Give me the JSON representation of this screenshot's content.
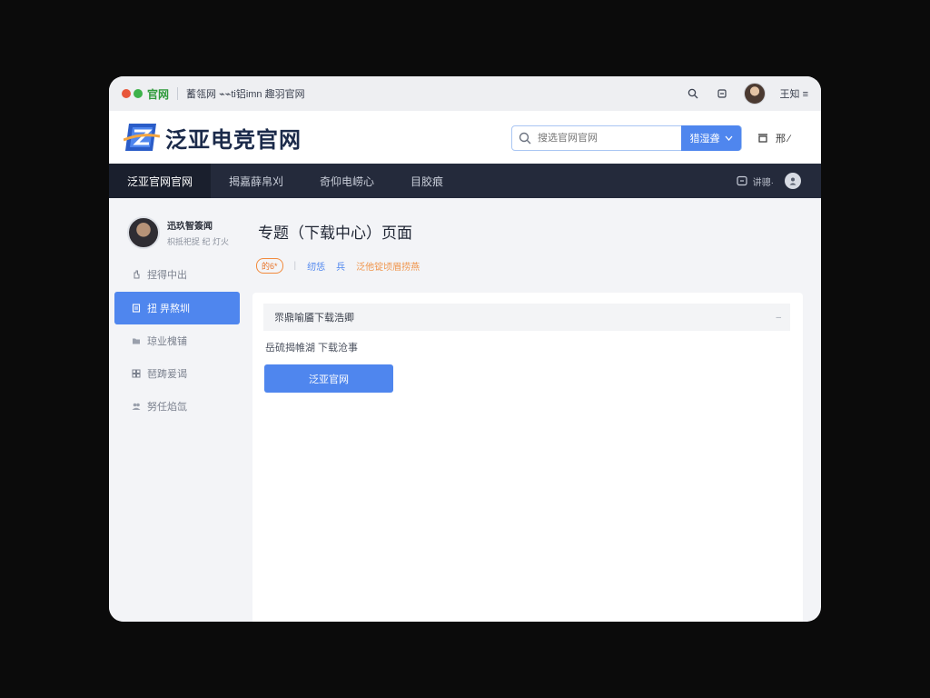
{
  "topbar": {
    "brand": "官网",
    "breadcrumb": "蓄瓴网 ⌁⌁ti铝imn 趣羽官网",
    "user_label": "王知 ≡",
    "colors": {
      "dot_red": "#e8563a",
      "dot_green": "#3db24a"
    }
  },
  "header": {
    "site_title": "泛亚电竞官网",
    "search_placeholder": "搜选官网官网",
    "search_button": "猎湿聋",
    "right_label": "邢 ∕"
  },
  "nav": {
    "items": [
      {
        "label": "泛亚官网官网"
      },
      {
        "label": "揭嘉薛帛刈"
      },
      {
        "label": "奇仰电崂心"
      },
      {
        "label": "目胶痕"
      }
    ],
    "message_label": "讲骢·"
  },
  "sidebar": {
    "profile_name": "迅玖智簽闻",
    "profile_sub": "枳抵祀捉 纪 灯火",
    "items": [
      {
        "label": "捏得中出",
        "icon": "hand-icon"
      },
      {
        "label": "扭 畀熬圳",
        "icon": "document-icon"
      },
      {
        "label": "琼业槐铺",
        "icon": "folder-icon"
      },
      {
        "label": "琶踌爰谒",
        "icon": "grid-icon"
      },
      {
        "label": "努任焰氙",
        "icon": "group-icon"
      }
    ]
  },
  "main": {
    "heading": "专题（下载中心）页面",
    "badge": "的6*",
    "meta_link1": "纫恁",
    "meta_link2": "兵",
    "meta_extra": "泛他锭顷眉捞燕",
    "card_header": "眔鼎喻靥下载浩卿",
    "card_desc": "岳硫揭帷湖  下载沧事",
    "card_button": "泛亚官网"
  },
  "colors": {
    "accent": "#4f86ee",
    "nav_bg": "#242a3b",
    "badge_orange": "#e8742a"
  }
}
